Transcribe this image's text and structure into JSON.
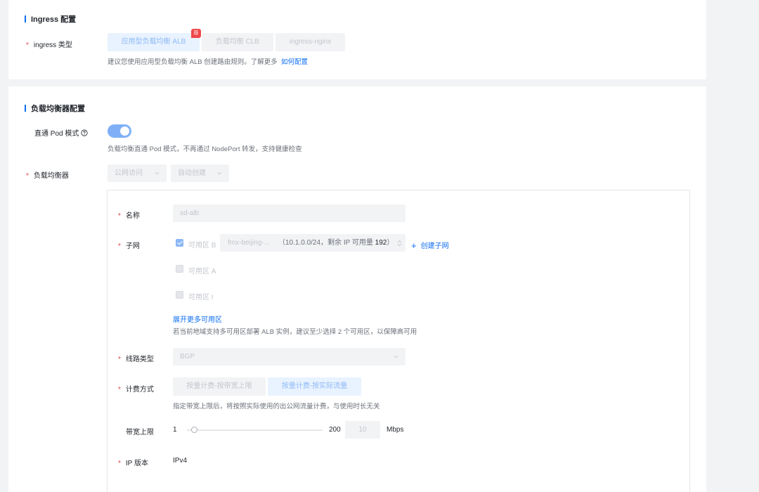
{
  "ingress_section": {
    "title": "Ingress 配置",
    "type_label": "ingress 类型",
    "required_mark": "*",
    "options": [
      {
        "label": "应用型负载均衡 ALB",
        "active": true,
        "badge": "荐"
      },
      {
        "label": "负载均衡 CLB",
        "active": false
      },
      {
        "label": "ingress-nginx",
        "active": false
      }
    ],
    "hint_text": "建议您使用应用型负载均衡 ALB 创建路由规则。了解更多",
    "hint_link": "如何配置"
  },
  "lb_section": {
    "title": "负载均衡器配置",
    "direct_pod": {
      "label": "直通 Pod 模式",
      "help_icon": "question-circle-icon",
      "enabled": true,
      "hint": "负载均衡直通 Pod 模式，不再通过 NodePort 转发，支持健康检查"
    },
    "balancer": {
      "label": "负载均衡器",
      "access_select": "公网访问",
      "create_select": "自动创建"
    },
    "form": {
      "name": {
        "label": "名称",
        "placeholder": "sd-alb"
      },
      "subnet": {
        "label": "子网",
        "zones": [
          {
            "label": "可用区 B",
            "checked": true
          },
          {
            "label": "可用区 A",
            "checked": false
          },
          {
            "label": "可用区 I",
            "checked": false
          }
        ],
        "subnet_name": "fmx-beijing-...",
        "subnet_info": "（10.1.0.0/24，剩余 IP 可用量 ",
        "subnet_available": "192",
        "subnet_info_end": "）",
        "create_subnet_link": "创建子网",
        "expand_link": "展开更多可用区",
        "hint": "若当前地域支持多可用区部署 ALB 实例，建议至少选择 2 个可用区，以保障高可用"
      },
      "line_type": {
        "label": "线路类型",
        "value": "BGP"
      },
      "billing": {
        "label": "计费方式",
        "options": [
          {
            "label": "按量计费-按带宽上限",
            "active": false
          },
          {
            "label": "按量计费-按实际流量",
            "active": true
          }
        ],
        "hint": "指定带宽上限后，将按照实际使用的出公网流量计费，与使用时长无关"
      },
      "bandwidth": {
        "label": "带宽上限",
        "min": "1",
        "max": "200",
        "value": "10",
        "unit": "Mbps",
        "level": 0.05
      },
      "ip_version": {
        "label": "IP 版本",
        "value": "IPv4"
      }
    }
  }
}
